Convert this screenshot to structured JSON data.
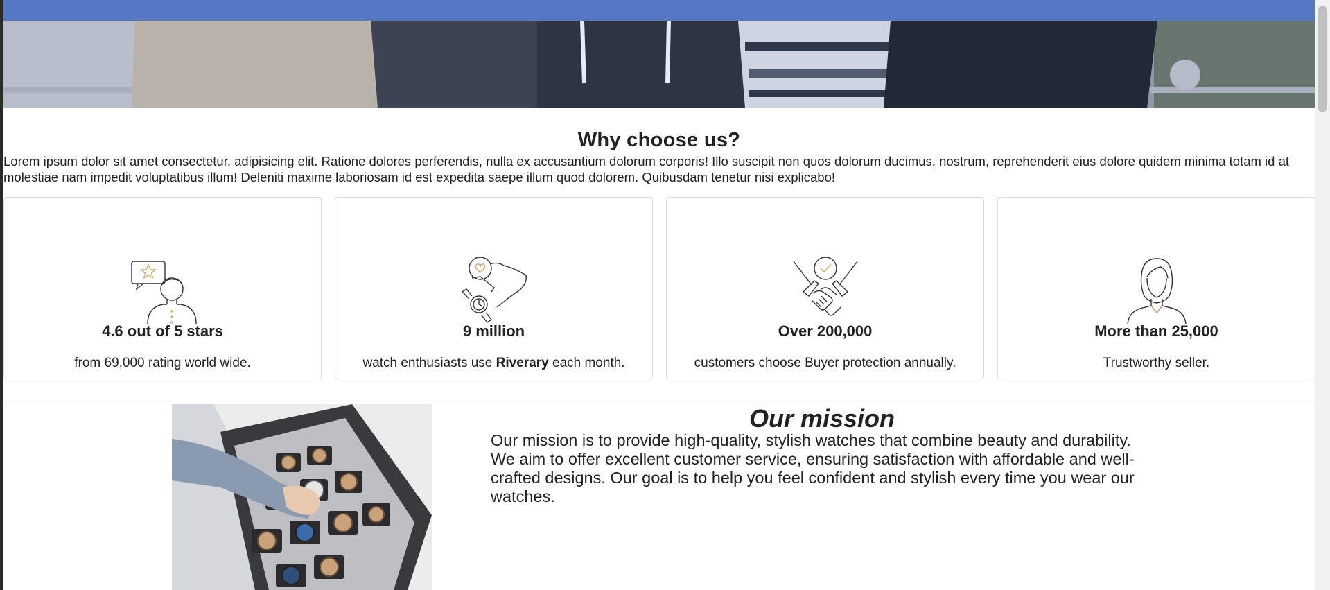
{
  "colors": {
    "topbar": "#5479c2",
    "text": "#222222",
    "accent_icon": "#d9a86a"
  },
  "why": {
    "title": "Why choose us?",
    "text": "Lorem ipsum dolor sit amet consectetur, adipisicing elit. Ratione dolores perferendis, nulla ex accusantium dolorum corporis! Illo suscipit non quos dolorum ducimus, nostrum, reprehenderit eius dolore quidem minima totam id at molestiae nam impedit voluptatibus illum! Deleniti maxime laboriosam id est expedita saepe illum quod dolorem. Quibusdam tenetur nisi explicabo!"
  },
  "features": [
    {
      "icon": "review-star-person-icon",
      "stat": "4.6 out of 5 stars",
      "desc": "from 69,000 rating world wide."
    },
    {
      "icon": "watch-hand-heart-icon",
      "stat": "9 million",
      "desc_pre": "watch enthusiasts use ",
      "desc_bold": "Riverary",
      "desc_post": " each month."
    },
    {
      "icon": "handshake-check-icon",
      "stat": "Over 200,000",
      "desc": "customers choose Buyer protection annually."
    },
    {
      "icon": "seller-woman-icon",
      "stat": "More than 25,000",
      "desc": "Trustworthy seller."
    }
  ],
  "mission": {
    "title": "Our mission",
    "text": "Our mission is to provide high-quality, stylish watches that combine beauty and durability. We aim to offer excellent customer service, ensuring satisfaction with affordable and well-crafted designs. Our goal is to help you feel confident and stylish every time you wear our watches."
  }
}
